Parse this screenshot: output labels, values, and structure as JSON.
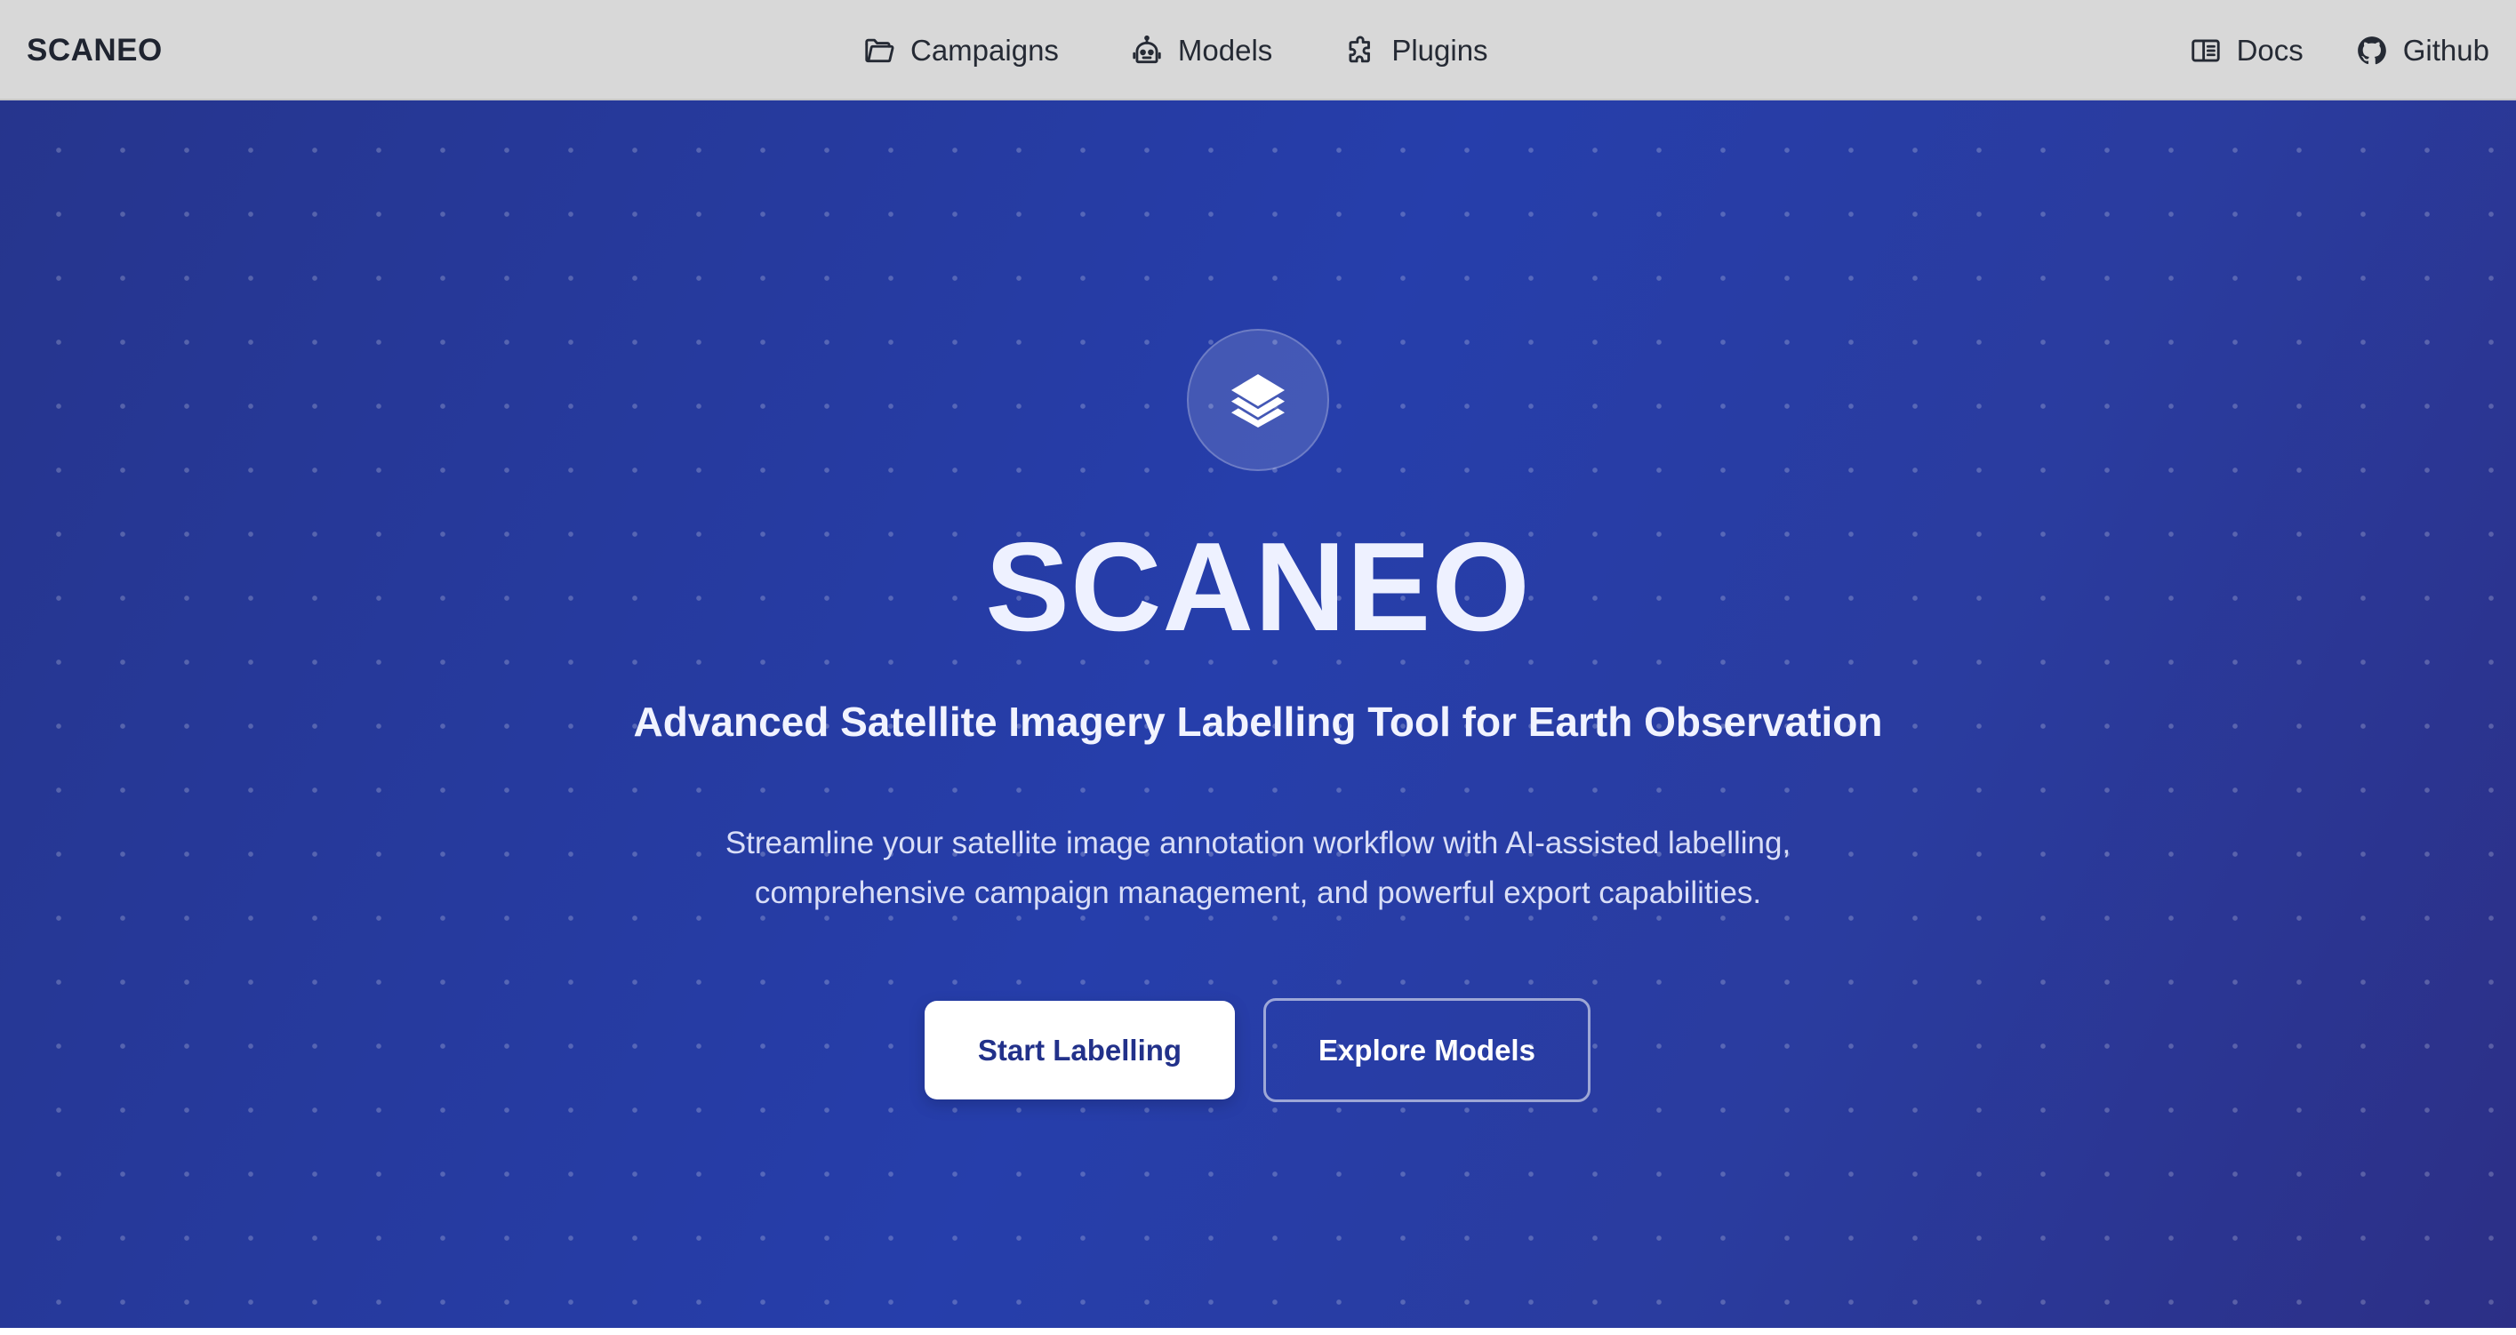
{
  "navbar": {
    "brand": "SCANEO",
    "center_items": [
      {
        "label": "Campaigns",
        "icon": "folder-open-icon"
      },
      {
        "label": "Models",
        "icon": "robot-icon"
      },
      {
        "label": "Plugins",
        "icon": "puzzle-icon"
      }
    ],
    "right_items": [
      {
        "label": "Docs",
        "icon": "book-icon"
      },
      {
        "label": "Github",
        "icon": "github-icon"
      }
    ]
  },
  "hero": {
    "logo_icon": "layers-icon",
    "title": "SCANEO",
    "subtitle": "Advanced Satellite Imagery Labelling Tool for Earth Observation",
    "description_line1": "Streamline your satellite image annotation workflow with AI-assisted labelling,",
    "description_line2": "comprehensive campaign management, and powerful export capabilities.",
    "primary_button": "Start Labelling",
    "secondary_button": "Explore Models"
  },
  "colors": {
    "navbar_bg": "#d8d8d8",
    "hero_bg_start": "#26358d",
    "hero_bg_mid": "#263eab",
    "hero_bg_end": "#2c2f86",
    "primary_button_text": "#22318a"
  }
}
